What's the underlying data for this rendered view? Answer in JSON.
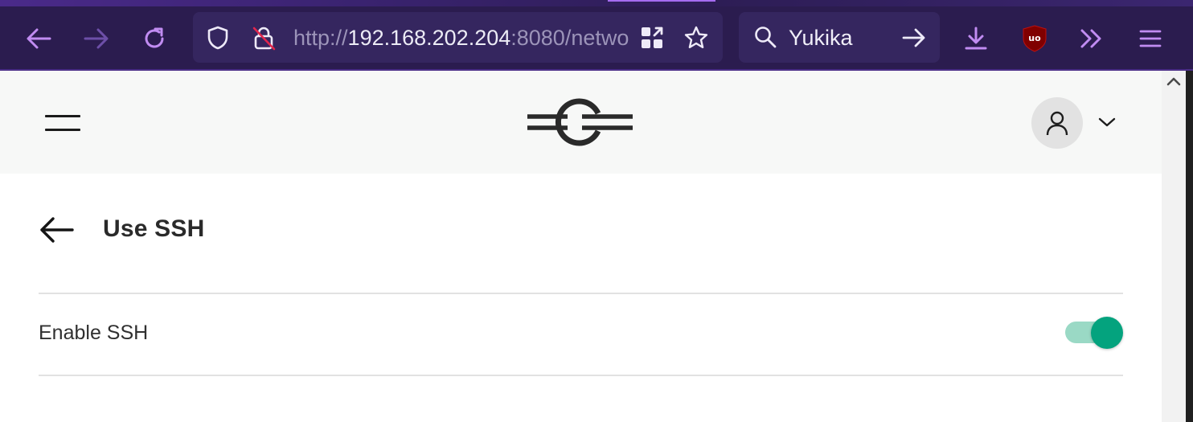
{
  "browser": {
    "url_scheme": "http://",
    "url_host": "192.168.202.204",
    "url_rest": ":8080/netwo",
    "search_text": "Yukika",
    "colors": {
      "chrome_bg": "#2b1c4f",
      "icon_accent": "#c18cf2",
      "field_bg": "#35265f"
    },
    "icons": {
      "back": "arrow-left-icon",
      "forward": "arrow-right-icon",
      "reload": "reload-icon",
      "shield": "shield-icon",
      "insecure": "insecure-lock-icon",
      "qr": "qr-code-icon",
      "bookmark": "star-icon",
      "search": "magnifier-icon",
      "go": "arrow-right-icon",
      "download": "download-icon",
      "ublock": "ublock-origin-icon",
      "overflow": "double-chevron-icon",
      "menu": "hamburger-menu-icon"
    }
  },
  "page": {
    "header": {
      "logo": "gateway-logo",
      "avatar": "user-avatar-icon"
    },
    "title": "Use SSH",
    "setting": {
      "label": "Enable SSH",
      "enabled": true
    },
    "colors": {
      "toggle_on": "#04a37e",
      "toggle_track": "#9ad9c5",
      "header_bg": "#f7f8f7"
    }
  }
}
